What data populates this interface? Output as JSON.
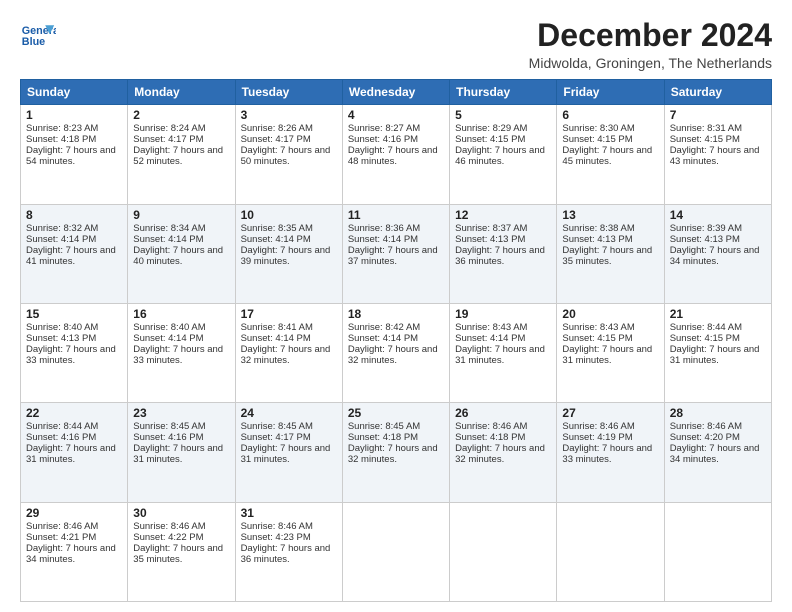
{
  "logo": {
    "line1": "General",
    "line2": "Blue"
  },
  "title": "December 2024",
  "subtitle": "Midwolda, Groningen, The Netherlands",
  "days": [
    "Sunday",
    "Monday",
    "Tuesday",
    "Wednesday",
    "Thursday",
    "Friday",
    "Saturday"
  ],
  "weeks": [
    [
      {
        "day": "1",
        "sunrise": "Sunrise: 8:23 AM",
        "sunset": "Sunset: 4:18 PM",
        "daylight": "Daylight: 7 hours and 54 minutes."
      },
      {
        "day": "2",
        "sunrise": "Sunrise: 8:24 AM",
        "sunset": "Sunset: 4:17 PM",
        "daylight": "Daylight: 7 hours and 52 minutes."
      },
      {
        "day": "3",
        "sunrise": "Sunrise: 8:26 AM",
        "sunset": "Sunset: 4:17 PM",
        "daylight": "Daylight: 7 hours and 50 minutes."
      },
      {
        "day": "4",
        "sunrise": "Sunrise: 8:27 AM",
        "sunset": "Sunset: 4:16 PM",
        "daylight": "Daylight: 7 hours and 48 minutes."
      },
      {
        "day": "5",
        "sunrise": "Sunrise: 8:29 AM",
        "sunset": "Sunset: 4:15 PM",
        "daylight": "Daylight: 7 hours and 46 minutes."
      },
      {
        "day": "6",
        "sunrise": "Sunrise: 8:30 AM",
        "sunset": "Sunset: 4:15 PM",
        "daylight": "Daylight: 7 hours and 45 minutes."
      },
      {
        "day": "7",
        "sunrise": "Sunrise: 8:31 AM",
        "sunset": "Sunset: 4:15 PM",
        "daylight": "Daylight: 7 hours and 43 minutes."
      }
    ],
    [
      {
        "day": "8",
        "sunrise": "Sunrise: 8:32 AM",
        "sunset": "Sunset: 4:14 PM",
        "daylight": "Daylight: 7 hours and 41 minutes."
      },
      {
        "day": "9",
        "sunrise": "Sunrise: 8:34 AM",
        "sunset": "Sunset: 4:14 PM",
        "daylight": "Daylight: 7 hours and 40 minutes."
      },
      {
        "day": "10",
        "sunrise": "Sunrise: 8:35 AM",
        "sunset": "Sunset: 4:14 PM",
        "daylight": "Daylight: 7 hours and 39 minutes."
      },
      {
        "day": "11",
        "sunrise": "Sunrise: 8:36 AM",
        "sunset": "Sunset: 4:14 PM",
        "daylight": "Daylight: 7 hours and 37 minutes."
      },
      {
        "day": "12",
        "sunrise": "Sunrise: 8:37 AM",
        "sunset": "Sunset: 4:13 PM",
        "daylight": "Daylight: 7 hours and 36 minutes."
      },
      {
        "day": "13",
        "sunrise": "Sunrise: 8:38 AM",
        "sunset": "Sunset: 4:13 PM",
        "daylight": "Daylight: 7 hours and 35 minutes."
      },
      {
        "day": "14",
        "sunrise": "Sunrise: 8:39 AM",
        "sunset": "Sunset: 4:13 PM",
        "daylight": "Daylight: 7 hours and 34 minutes."
      }
    ],
    [
      {
        "day": "15",
        "sunrise": "Sunrise: 8:40 AM",
        "sunset": "Sunset: 4:13 PM",
        "daylight": "Daylight: 7 hours and 33 minutes."
      },
      {
        "day": "16",
        "sunrise": "Sunrise: 8:40 AM",
        "sunset": "Sunset: 4:14 PM",
        "daylight": "Daylight: 7 hours and 33 minutes."
      },
      {
        "day": "17",
        "sunrise": "Sunrise: 8:41 AM",
        "sunset": "Sunset: 4:14 PM",
        "daylight": "Daylight: 7 hours and 32 minutes."
      },
      {
        "day": "18",
        "sunrise": "Sunrise: 8:42 AM",
        "sunset": "Sunset: 4:14 PM",
        "daylight": "Daylight: 7 hours and 32 minutes."
      },
      {
        "day": "19",
        "sunrise": "Sunrise: 8:43 AM",
        "sunset": "Sunset: 4:14 PM",
        "daylight": "Daylight: 7 hours and 31 minutes."
      },
      {
        "day": "20",
        "sunrise": "Sunrise: 8:43 AM",
        "sunset": "Sunset: 4:15 PM",
        "daylight": "Daylight: 7 hours and 31 minutes."
      },
      {
        "day": "21",
        "sunrise": "Sunrise: 8:44 AM",
        "sunset": "Sunset: 4:15 PM",
        "daylight": "Daylight: 7 hours and 31 minutes."
      }
    ],
    [
      {
        "day": "22",
        "sunrise": "Sunrise: 8:44 AM",
        "sunset": "Sunset: 4:16 PM",
        "daylight": "Daylight: 7 hours and 31 minutes."
      },
      {
        "day": "23",
        "sunrise": "Sunrise: 8:45 AM",
        "sunset": "Sunset: 4:16 PM",
        "daylight": "Daylight: 7 hours and 31 minutes."
      },
      {
        "day": "24",
        "sunrise": "Sunrise: 8:45 AM",
        "sunset": "Sunset: 4:17 PM",
        "daylight": "Daylight: 7 hours and 31 minutes."
      },
      {
        "day": "25",
        "sunrise": "Sunrise: 8:45 AM",
        "sunset": "Sunset: 4:18 PM",
        "daylight": "Daylight: 7 hours and 32 minutes."
      },
      {
        "day": "26",
        "sunrise": "Sunrise: 8:46 AM",
        "sunset": "Sunset: 4:18 PM",
        "daylight": "Daylight: 7 hours and 32 minutes."
      },
      {
        "day": "27",
        "sunrise": "Sunrise: 8:46 AM",
        "sunset": "Sunset: 4:19 PM",
        "daylight": "Daylight: 7 hours and 33 minutes."
      },
      {
        "day": "28",
        "sunrise": "Sunrise: 8:46 AM",
        "sunset": "Sunset: 4:20 PM",
        "daylight": "Daylight: 7 hours and 34 minutes."
      }
    ],
    [
      {
        "day": "29",
        "sunrise": "Sunrise: 8:46 AM",
        "sunset": "Sunset: 4:21 PM",
        "daylight": "Daylight: 7 hours and 34 minutes."
      },
      {
        "day": "30",
        "sunrise": "Sunrise: 8:46 AM",
        "sunset": "Sunset: 4:22 PM",
        "daylight": "Daylight: 7 hours and 35 minutes."
      },
      {
        "day": "31",
        "sunrise": "Sunrise: 8:46 AM",
        "sunset": "Sunset: 4:23 PM",
        "daylight": "Daylight: 7 hours and 36 minutes."
      },
      null,
      null,
      null,
      null
    ]
  ]
}
